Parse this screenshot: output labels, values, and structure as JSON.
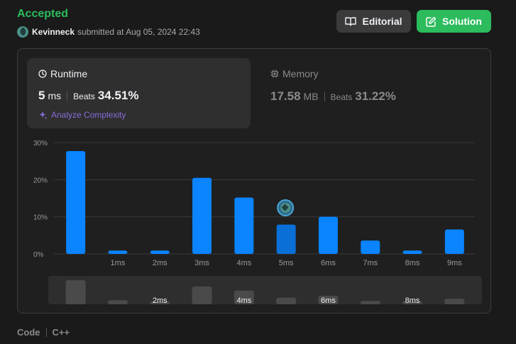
{
  "header": {
    "status": "Accepted",
    "username": "Kevinneck",
    "submitted_text": "submitted at Aug 05, 2024 22:43"
  },
  "buttons": {
    "editorial": "Editorial",
    "solution": "Solution"
  },
  "runtime": {
    "title": "Runtime",
    "value": "5",
    "unit": "ms",
    "beats_label": "Beats",
    "beats_value": "34.51%",
    "analyze_label": "Analyze Complexity"
  },
  "memory": {
    "title": "Memory",
    "value": "17.58",
    "unit": "MB",
    "beats_label": "Beats",
    "beats_value": "31.22%"
  },
  "chart_data": {
    "type": "bar",
    "categories": [
      "",
      "1ms",
      "2ms",
      "3ms",
      "4ms",
      "5ms",
      "6ms",
      "7ms",
      "8ms",
      "9ms"
    ],
    "values": [
      27.7,
      0.9,
      0.9,
      20.5,
      15.2,
      7.9,
      10.0,
      3.6,
      0.9,
      6.6
    ],
    "y_ticks": [
      "0%",
      "10%",
      "20%",
      "30%"
    ],
    "ylim": [
      0,
      30
    ],
    "highlight_index": 5,
    "overview_values": [
      6.5,
      1.1,
      0.8,
      4.8,
      3.7,
      1.8,
      2.3,
      0.9,
      0.8,
      1.5
    ],
    "overview_labels": [
      {
        "index": 2,
        "text": "2ms"
      },
      {
        "index": 4,
        "text": "4ms"
      },
      {
        "index": 6,
        "text": "6ms"
      },
      {
        "index": 8,
        "text": "8ms"
      }
    ]
  },
  "footer": {
    "code_label": "Code",
    "language": "C++"
  },
  "colors": {
    "accent_green": "#2cbb5d",
    "bar_blue": "#0a84ff",
    "bar_highlight": "#0a6fd6"
  }
}
